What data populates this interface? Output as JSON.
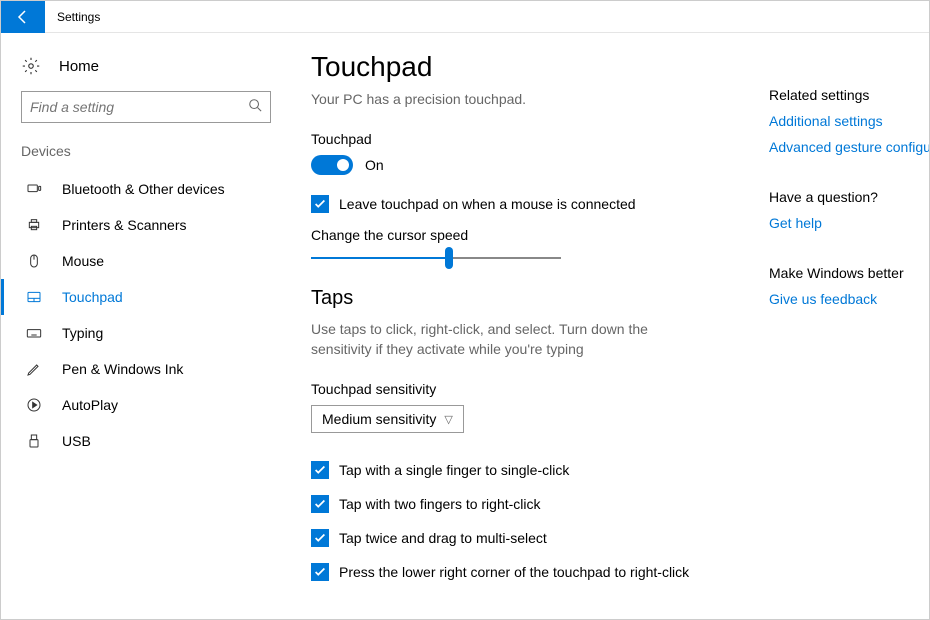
{
  "app": {
    "title": "Settings"
  },
  "sidebar": {
    "home": "Home",
    "search_placeholder": "Find a setting",
    "category": "Devices",
    "items": [
      {
        "label": "Bluetooth & Other devices"
      },
      {
        "label": "Printers & Scanners"
      },
      {
        "label": "Mouse"
      },
      {
        "label": "Touchpad"
      },
      {
        "label": "Typing"
      },
      {
        "label": "Pen & Windows Ink"
      },
      {
        "label": "AutoPlay"
      },
      {
        "label": "USB"
      }
    ]
  },
  "main": {
    "title": "Touchpad",
    "subtitle": "Your PC has a precision touchpad.",
    "touchpad_label": "Touchpad",
    "toggle_state": "On",
    "leave_on": "Leave touchpad on when a mouse is connected",
    "cursor_speed": "Change the cursor speed",
    "taps_title": "Taps",
    "taps_desc": "Use taps to click, right-click, and select. Turn down the sensitivity if they activate while you're typing",
    "sensitivity_label": "Touchpad sensitivity",
    "sensitivity_value": "Medium sensitivity",
    "checks": [
      "Tap with a single finger to single-click",
      "Tap with two fingers to right-click",
      "Tap twice and drag to multi-select",
      "Press the lower right corner of the touchpad to right-click"
    ]
  },
  "right": {
    "related_head": "Related settings",
    "related_links": [
      "Additional settings",
      "Advanced gesture configuration"
    ],
    "question_head": "Have a question?",
    "question_link": "Get help",
    "better_head": "Make Windows better",
    "better_link": "Give us feedback"
  }
}
